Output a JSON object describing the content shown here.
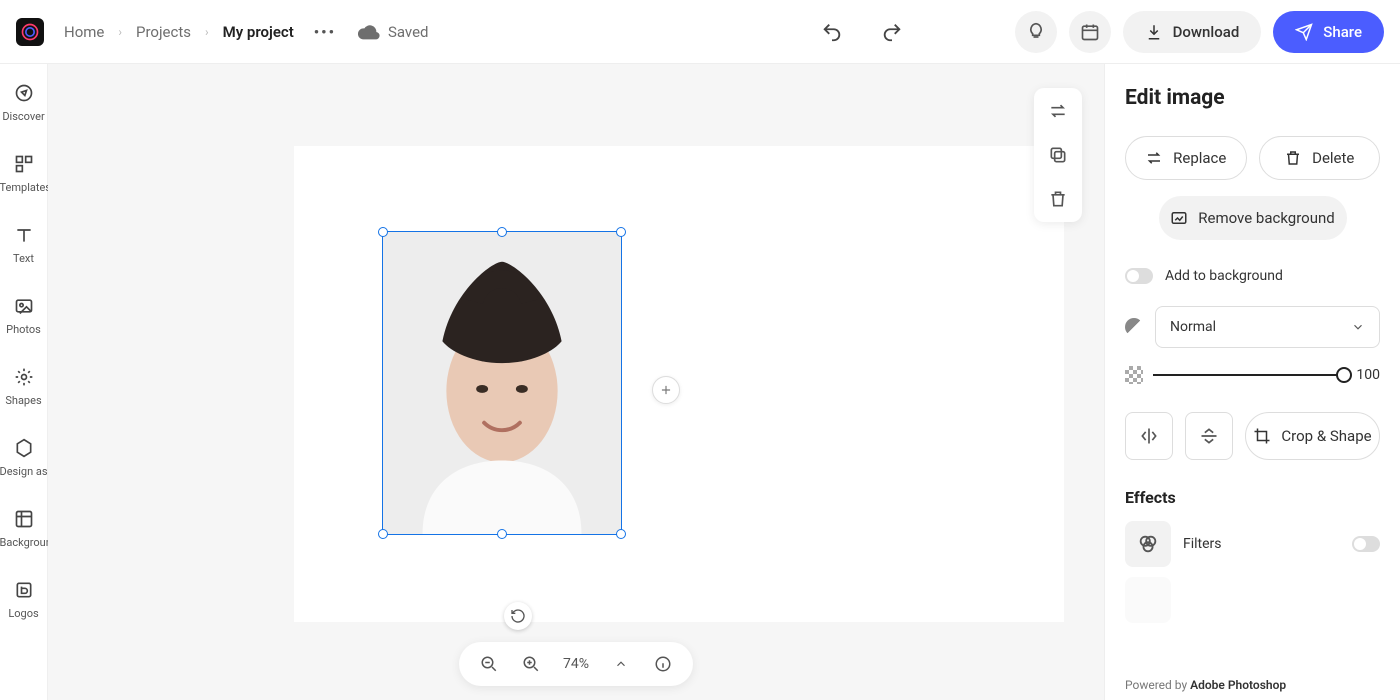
{
  "breadcrumbs": {
    "home": "Home",
    "projects": "Projects",
    "current": "My project"
  },
  "save_status": "Saved",
  "topbar": {
    "download": "Download",
    "share": "Share"
  },
  "leftrail": [
    {
      "label": "Discover",
      "name": "discover"
    },
    {
      "label": "Templates",
      "name": "templates"
    },
    {
      "label": "Text",
      "name": "text"
    },
    {
      "label": "Photos",
      "name": "photos"
    },
    {
      "label": "Shapes",
      "name": "shapes"
    },
    {
      "label": "Design assets",
      "name": "design-assets"
    },
    {
      "label": "Backgrounds",
      "name": "backgrounds"
    },
    {
      "label": "Logos",
      "name": "logos"
    }
  ],
  "zoom": {
    "level": "74%"
  },
  "right_panel": {
    "title": "Edit image",
    "replace": "Replace",
    "delete": "Delete",
    "remove_bg": "Remove background",
    "add_to_bg": "Add to background",
    "blend_mode": "Normal",
    "opacity_value": "100",
    "crop_shape": "Crop & Shape",
    "effects_title": "Effects",
    "filters": "Filters",
    "powered_prefix": "Powered by ",
    "powered_brand": "Adobe Photoshop"
  }
}
